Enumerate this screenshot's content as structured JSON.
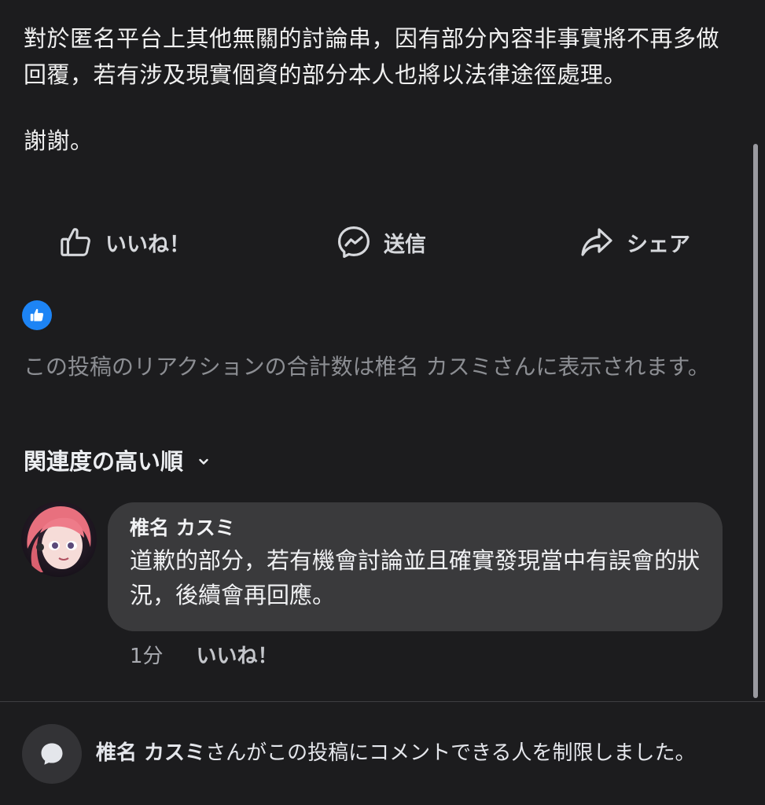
{
  "post": {
    "paragraph": "對於匿名平台上其他無關的討論串，因有部分內容非事實將不再多做回覆，若有涉及現實個資的部分本人也將以法律途徑處理。",
    "thanks": "謝謝。"
  },
  "actions": {
    "like_label": "いいね！",
    "send_label": "送信",
    "share_label": "シェア"
  },
  "reactions": {
    "note": "この投稿のリアクションの合計数は椎名 カスミさんに表示されます。"
  },
  "comments_sort": {
    "label": "関連度の高い順"
  },
  "comment": {
    "author": "椎名 カスミ",
    "text": "道歉的部分，若有機會討論並且確實發現當中有誤會的狀況，後續會再回應。",
    "time": "1分",
    "like_label": "いいね！"
  },
  "footer": {
    "name": "椎名 カスミ",
    "message": "さんがこの投稿にコメントできる人を制限しました。"
  },
  "colors": {
    "background": "#1c1c1e",
    "bubble": "#3a3a3c",
    "like_badge": "#1d84f5"
  },
  "icons": {
    "like": "thumbs-up-icon",
    "send": "messenger-icon",
    "share": "share-arrow-icon",
    "badge": "like-reaction-icon",
    "sort": "chevron-down-icon",
    "footer": "comment-bubble-icon"
  }
}
